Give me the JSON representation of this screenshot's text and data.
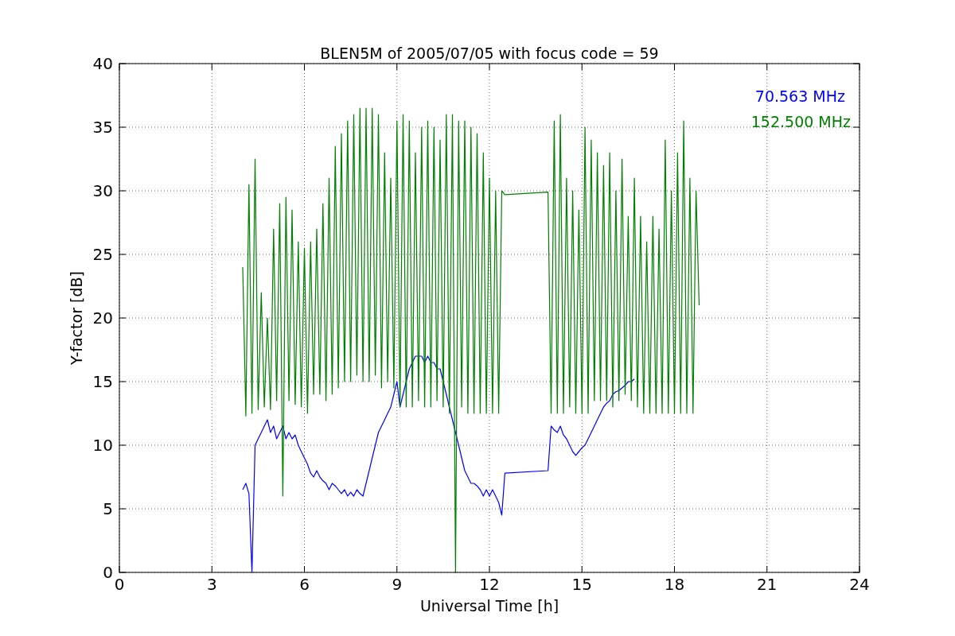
{
  "figure": {
    "chart_data": {
      "type": "line",
      "title": "BLEN5M of 2005/07/05 with focus code = 59",
      "xlabel": "Universal Time [h]",
      "ylabel": "Y-factor [dB]",
      "xlim": [
        0,
        24
      ],
      "ylim": [
        0,
        40
      ],
      "xticks": [
        0,
        3,
        6,
        9,
        12,
        15,
        18,
        21,
        24
      ],
      "yticks": [
        0,
        5,
        10,
        15,
        20,
        25,
        30,
        35,
        40
      ],
      "grid": true,
      "x": [
        4.0,
        4.1,
        4.2,
        4.3,
        4.4,
        4.5,
        4.6,
        4.7,
        4.8,
        4.9,
        5.0,
        5.1,
        5.2,
        5.3,
        5.4,
        5.5,
        5.6,
        5.7,
        5.8,
        5.9,
        6.0,
        6.1,
        6.2,
        6.3,
        6.4,
        6.5,
        6.6,
        6.7,
        6.8,
        6.9,
        7.0,
        7.1,
        7.2,
        7.3,
        7.4,
        7.5,
        7.6,
        7.7,
        7.8,
        7.9,
        8.0,
        8.1,
        8.2,
        8.3,
        8.4,
        8.5,
        8.6,
        8.7,
        8.8,
        8.9,
        9.0,
        9.1,
        9.2,
        9.3,
        9.4,
        9.5,
        9.6,
        9.7,
        9.8,
        9.9,
        10.0,
        10.1,
        10.2,
        10.3,
        10.4,
        10.5,
        10.6,
        10.7,
        10.8,
        10.9,
        11.0,
        11.1,
        11.2,
        11.3,
        11.4,
        11.5,
        11.6,
        11.7,
        11.8,
        11.9,
        12.0,
        12.1,
        12.2,
        12.3,
        12.4,
        12.5,
        13.9,
        14.0,
        14.1,
        14.2,
        14.3,
        14.4,
        14.5,
        14.6,
        14.7,
        14.8,
        14.9,
        15.0,
        15.1,
        15.2,
        15.3,
        15.4,
        15.5,
        15.6,
        15.7,
        15.8,
        15.9,
        16.0,
        16.1,
        16.2,
        16.3,
        16.4,
        16.5,
        16.6,
        16.7,
        16.8,
        16.9,
        17.0,
        17.1,
        17.2,
        17.3,
        17.4,
        17.5,
        17.6,
        17.7,
        17.8,
        17.9,
        18.0,
        18.1,
        18.2,
        18.3,
        18.4,
        18.5,
        18.6,
        18.7,
        18.8
      ],
      "series": [
        {
          "name": "70.563 MHz",
          "color": "#0000ff",
          "values": [
            6.5,
            7,
            6.2,
            0,
            10,
            10.5,
            11,
            11.5,
            12,
            11,
            11.5,
            10.5,
            11,
            11.5,
            10.5,
            11,
            10.5,
            10.8,
            10,
            9.5,
            9,
            8.5,
            7.8,
            7.5,
            8,
            7.5,
            7.2,
            7,
            6.5,
            7,
            6.8,
            6.5,
            6.2,
            6.5,
            6,
            6.3,
            6,
            6.5,
            6.2,
            6,
            7,
            8,
            9,
            10,
            11,
            11.5,
            12,
            12.5,
            13,
            14,
            15,
            13,
            14,
            15,
            16,
            16.5,
            17,
            17,
            17,
            16.5,
            17,
            16.5,
            16.5,
            16,
            16,
            15,
            14,
            13,
            12,
            11,
            10,
            9,
            8,
            7.5,
            7,
            7,
            6.8,
            6.5,
            6,
            6.5,
            6,
            6.5,
            6,
            5.5,
            4.5,
            7.8,
            8,
            11.5,
            11.2,
            11,
            11.5,
            10.8,
            10.5,
            10,
            9.5,
            9.2,
            9.5,
            9.8,
            10,
            10.5,
            11,
            11.5,
            12,
            12.5,
            13,
            13.3,
            13.5,
            14,
            14.2,
            14.3,
            14.5,
            14.7,
            15,
            15,
            15.2,
            null,
            null,
            null,
            null,
            null,
            null,
            null,
            null,
            null,
            null,
            null,
            null,
            null,
            null,
            null,
            null,
            null,
            null,
            null,
            null,
            null
          ]
        },
        {
          "name": "152.500 MHz",
          "color": "#008000",
          "values": [
            24,
            12.3,
            30.5,
            12.5,
            32.5,
            12.8,
            22,
            13,
            20,
            12.8,
            27,
            13.5,
            29,
            6,
            29.5,
            13.5,
            28.5,
            13.2,
            26,
            13,
            25.5,
            12.5,
            26,
            14,
            27,
            14,
            29,
            13.5,
            31,
            14,
            33.5,
            14.5,
            34.5,
            15,
            35.5,
            15,
            36,
            15.5,
            36.5,
            15,
            36.5,
            15,
            36.5,
            15.5,
            36,
            14.5,
            33,
            15,
            31,
            14.5,
            35.5,
            13,
            36,
            13,
            35.5,
            13,
            33,
            13.5,
            35,
            13,
            35.5,
            13,
            35,
            13.5,
            34,
            13,
            36,
            12.5,
            36,
            0,
            35.5,
            13,
            35.5,
            12.5,
            35,
            12.5,
            34.5,
            12.5,
            33,
            12.5,
            31,
            12.5,
            30,
            12.5,
            30,
            29.7,
            29.9,
            12.5,
            35.5,
            12.5,
            36,
            12.5,
            31,
            13,
            30,
            12.5,
            28.5,
            12.5,
            35,
            12.5,
            34,
            13.5,
            33,
            13.5,
            32,
            13.5,
            33,
            13,
            30,
            13.5,
            32.5,
            14,
            28,
            13.5,
            31,
            13,
            28,
            12.5,
            26,
            12.5,
            28,
            12.5,
            27,
            12.5,
            34,
            12.5,
            30,
            12.5,
            33,
            12.5,
            35.5,
            12.5,
            31,
            12.5,
            30,
            21
          ]
        }
      ]
    }
  }
}
